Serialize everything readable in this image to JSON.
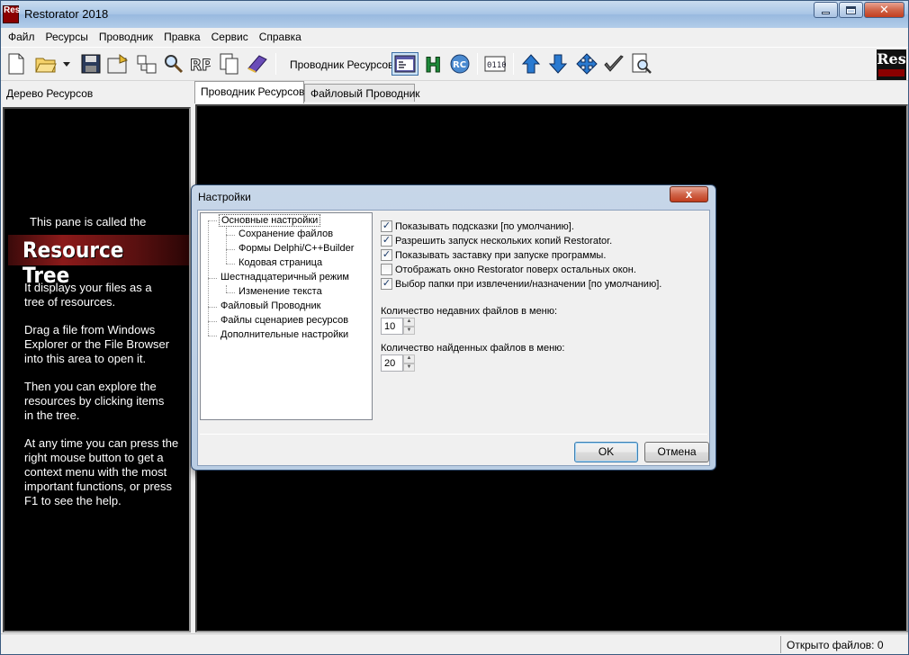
{
  "window": {
    "title": "Restorator 2018",
    "app_icon_text": "Res"
  },
  "menu": [
    "Файл",
    "Ресурсы",
    "Проводник",
    "Правка",
    "Сервис",
    "Справка"
  ],
  "toolbar": {
    "explorer_label": "Проводник Ресурсов:",
    "buttons": [
      "new-file",
      "open-folder",
      "dropdown",
      "save",
      "save-as",
      "move",
      "search",
      "rp",
      "copy",
      "book",
      "view-resources",
      "h",
      "rc",
      "binary",
      "up",
      "down",
      "expand",
      "check",
      "find"
    ],
    "logo_text": "Res"
  },
  "left": {
    "header": "Дерево Ресурсов",
    "intro": "This pane is called the",
    "banner": "Resource Tree",
    "lines": [
      "It displays your files as a",
      "tree of resources.",
      "Drag a file from Windows",
      "Explorer or the File Browser",
      "into this area to open it.",
      "Then you can explore the",
      "resources by clicking items",
      "in the tree.",
      "At any time you can press the",
      "right mouse button to get a",
      "context menu with the most",
      "important functions, or press",
      "F1 to see the help."
    ]
  },
  "tabs": [
    {
      "label": "Проводник Ресурсов",
      "active": true
    },
    {
      "label": "Файловый Проводник",
      "active": false
    }
  ],
  "status": {
    "files_open": "Открыто файлов: 0"
  },
  "dialog": {
    "title": "Настройки",
    "close": "x",
    "tree": [
      "Основные настройки",
      "Сохранение файлов",
      "Формы Delphi/C++Builder",
      "Кодовая страница",
      "Шестнадцатеричный режим",
      "Изменение текста",
      "Файловый Проводник",
      "Файлы сценариев ресурсов",
      "Дополнительные настройки"
    ],
    "options": [
      {
        "label": "Показывать подсказки [по умолчанию].",
        "checked": true
      },
      {
        "label": "Разрешить запуск нескольких копий Restorator.",
        "checked": true
      },
      {
        "label": "Показывать заставку при запуске программы.",
        "checked": true
      },
      {
        "label": "Отображать окно Restorator поверх остальных окон.",
        "checked": false
      },
      {
        "label": "Выбор папки при извлечении/назначении [по умолчанию].",
        "checked": true
      }
    ],
    "recent_label": "Количество недавних файлов в меню:",
    "recent_value": "10",
    "found_label": "Количество найденных файлов в меню:",
    "found_value": "20",
    "ok": "OK",
    "cancel": "Отмена"
  }
}
